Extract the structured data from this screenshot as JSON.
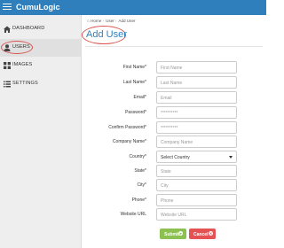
{
  "app": {
    "brand": "CumuLogic"
  },
  "sidebar": {
    "items": [
      {
        "label": "DASHBOARD",
        "icon": "dashboard-icon"
      },
      {
        "label": "USERS",
        "icon": "user-icon",
        "active": true
      },
      {
        "label": "IMAGES",
        "icon": "grid-icon"
      },
      {
        "label": "SETTINGS",
        "icon": "list-icon"
      }
    ]
  },
  "breadcrumb": {
    "home": "Home",
    "users": "User",
    "current": "Add User"
  },
  "page": {
    "title": "Add User"
  },
  "form": {
    "fields": [
      {
        "label": "First Name*",
        "placeholder": "First Name"
      },
      {
        "label": "Last Name*",
        "placeholder": "Last Name"
      },
      {
        "label": "Email*",
        "placeholder": "Email"
      },
      {
        "label": "Password*",
        "placeholder": "**********"
      },
      {
        "label": "Confirm Password*",
        "placeholder": "**********"
      },
      {
        "label": "Company Name*",
        "placeholder": "Company Name"
      },
      {
        "label": "Country*",
        "value": "Select Country"
      },
      {
        "label": "State*",
        "placeholder": "State"
      },
      {
        "label": "City*",
        "placeholder": "City"
      },
      {
        "label": "Phone*",
        "placeholder": "Phone"
      },
      {
        "label": "Website URL",
        "placeholder": "Website URL"
      }
    ],
    "submit_label": "Submit",
    "cancel_label": "Cancel"
  },
  "colors": {
    "accent": "#2f7fbd",
    "submit": "#8cc152",
    "cancel": "#e55253",
    "highlight": "#d9534f"
  }
}
